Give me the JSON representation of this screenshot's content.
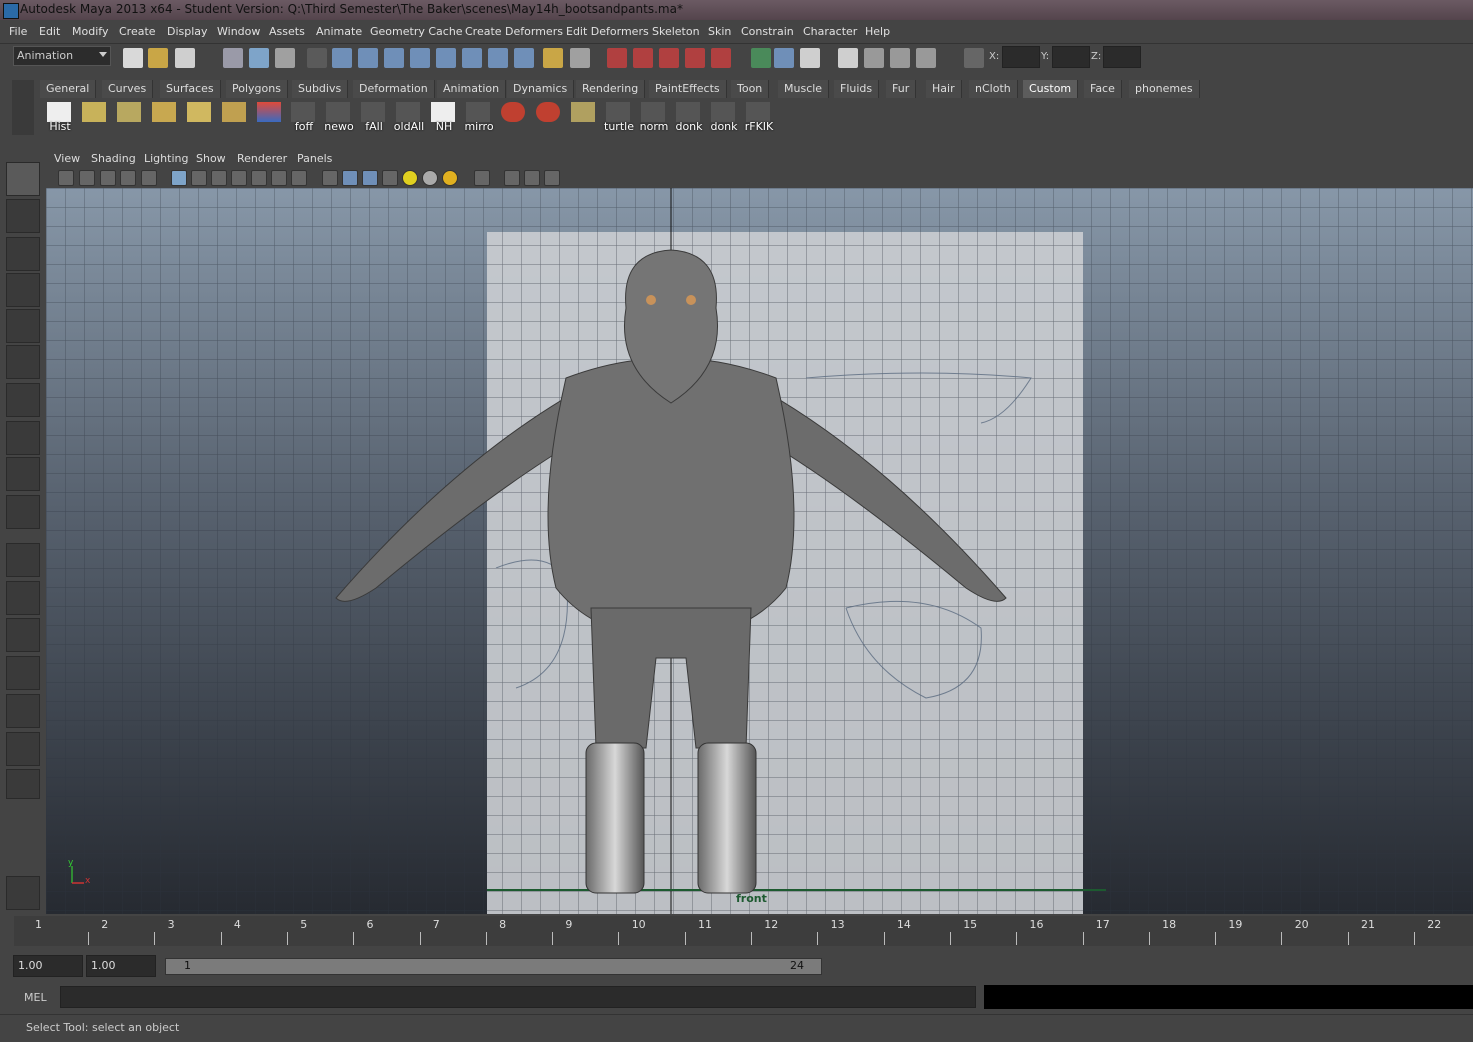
{
  "window": {
    "title": "Autodesk Maya 2013 x64 - Student Version: Q:\\Third Semester\\The Baker\\scenes\\May14h_bootsandpants.ma*"
  },
  "menubar": [
    "File",
    "Edit",
    "Modify",
    "Create",
    "Display",
    "Window",
    "Assets",
    "Animate",
    "Geometry Cache",
    "Create Deformers",
    "Edit Deformers",
    "Skeleton",
    "Skin",
    "Constrain",
    "Character",
    "Help"
  ],
  "statusline": {
    "menu_set": "Animation",
    "x_label": "X:",
    "y_label": "Y:",
    "z_label": "Z:"
  },
  "shelf": {
    "tabs": [
      "General",
      "Curves",
      "Surfaces",
      "Polygons",
      "Subdivs",
      "Deformation",
      "Animation",
      "Dynamics",
      "Rendering",
      "PaintEffects",
      "Toon",
      "Muscle",
      "Fluids",
      "Fur",
      "Hair",
      "nCloth",
      "Custom",
      "Face",
      "phonemes"
    ],
    "active_tab": "Custom",
    "buttons": [
      "Hist",
      "",
      "",
      "",
      "",
      "",
      "",
      "foff",
      "newo",
      "fAll",
      "oldAll",
      "NH",
      "mirro",
      "",
      "",
      "",
      "turtle",
      "norm",
      "donk",
      "donk",
      "rFKIK"
    ]
  },
  "viewport": {
    "menu": [
      "View",
      "Shading",
      "Lighting",
      "Show",
      "Renderer",
      "Panels"
    ],
    "camera_label": "front",
    "axis_x": "x",
    "axis_y": "y"
  },
  "timeline": {
    "ticks": [
      "1",
      "2",
      "3",
      "4",
      "5",
      "6",
      "7",
      "8",
      "9",
      "10",
      "11",
      "12",
      "13",
      "14",
      "15",
      "16",
      "17",
      "18",
      "19",
      "20",
      "21",
      "22"
    ]
  },
  "range": {
    "start_time": "1.00",
    "playback_start": "1.00",
    "range_start": "1",
    "range_end": "24"
  },
  "command_line": {
    "label": "MEL"
  },
  "help_line": {
    "text": "Select Tool: select an object"
  }
}
